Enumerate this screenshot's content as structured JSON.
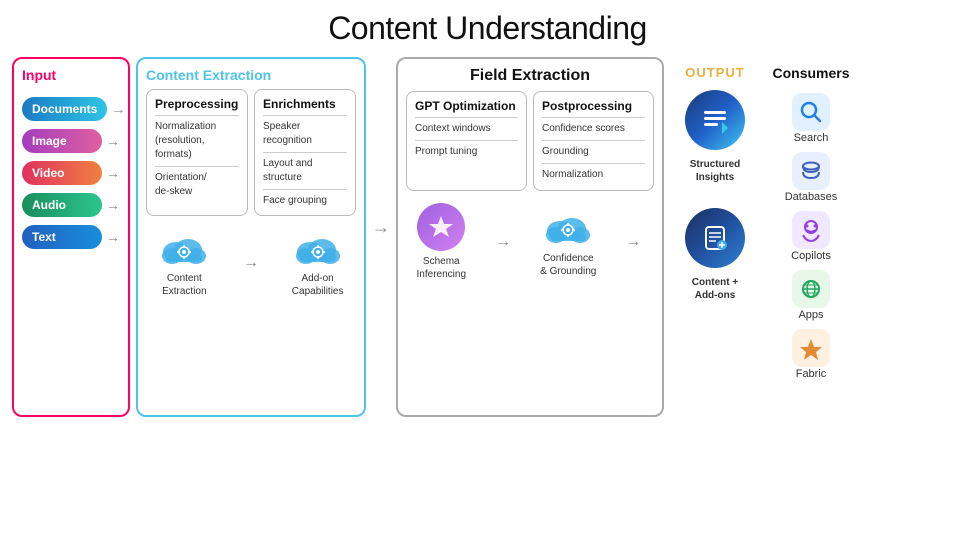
{
  "title": "Content Understanding",
  "input": {
    "label": "Input",
    "items": [
      {
        "label": "Documents",
        "class": "pill-documents"
      },
      {
        "label": "Image",
        "class": "pill-image"
      },
      {
        "label": "Video",
        "class": "pill-video"
      },
      {
        "label": "Audio",
        "class": "pill-audio"
      },
      {
        "label": "Text",
        "class": "pill-text"
      }
    ]
  },
  "content_extraction": {
    "label": "Content Extraction",
    "preprocessing": {
      "title": "Preprocessing",
      "items": [
        "Normalization (resolution, formats)",
        "Orientation/ de-skew"
      ]
    },
    "enrichments": {
      "title": "Enrichments",
      "items": [
        "Speaker recognition",
        "Layout and structure",
        "Face grouping"
      ]
    },
    "cloud1_label": "Content\nExtraction",
    "cloud2_label": "Add-on\nCapabilities"
  },
  "field_extraction": {
    "label": "Field Extraction",
    "gpt": {
      "title": "GPT Optimization",
      "items": [
        "Context windows",
        "Prompt tuning"
      ]
    },
    "postprocessing": {
      "title": "Postprocessing",
      "items": [
        "Confidence scores",
        "Grounding",
        "Normalization"
      ]
    },
    "schema_label": "Schema\nInferencing",
    "confidence_label": "Confidence\n& Grounding"
  },
  "output": {
    "label": "OUTPUT",
    "structured_insights": "Structured\nInsights",
    "content_addons": "Content +\nAdd-ons"
  },
  "consumers": {
    "label": "Consumers",
    "items": [
      {
        "label": "Search",
        "icon": "🔍",
        "color": "#e8f4ff"
      },
      {
        "label": "Databases",
        "icon": "💿",
        "color": "#e8f0ff"
      },
      {
        "label": "Copilots",
        "icon": "🤖",
        "color": "#f0e8ff"
      },
      {
        "label": "Apps",
        "icon": "🌐",
        "color": "#e8f8f0"
      },
      {
        "label": "Fabric",
        "icon": "⚡",
        "color": "#fff0e8"
      }
    ]
  }
}
